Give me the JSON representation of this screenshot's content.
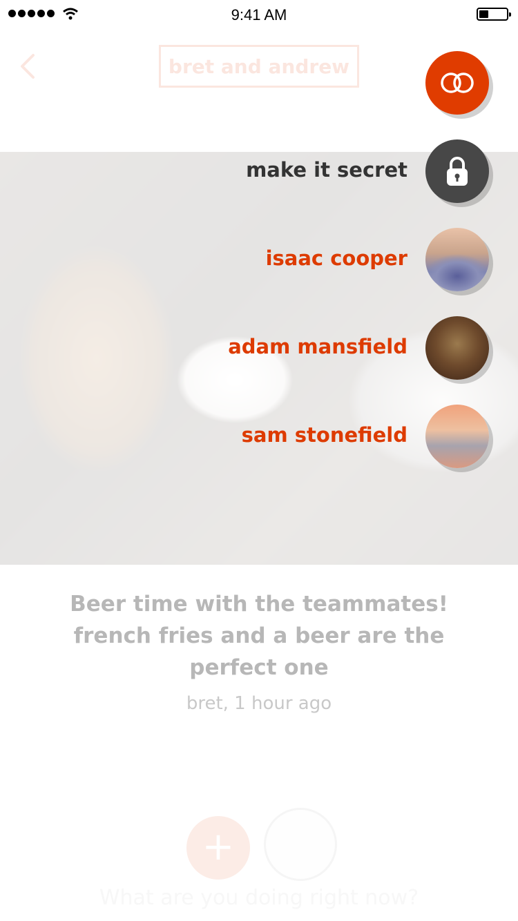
{
  "status_bar": {
    "time": "9:41 AM",
    "battery_level": 0.35
  },
  "header": {
    "title": "bret and andrew",
    "back_icon": "chevron-left-icon"
  },
  "post": {
    "caption": "Beer time with the teammates! french fries and a beer are the perfect one",
    "meta": "bret, 1 hour ago",
    "bottom_prompt": "What are you doing right now?"
  },
  "fab": {
    "icon": "linked-rings-icon",
    "color": "#e03c00"
  },
  "menu": {
    "secret_label": "make it secret",
    "secret_icon": "lock-icon",
    "people": [
      {
        "name": "isaac cooper"
      },
      {
        "name": "adam mansfield"
      },
      {
        "name": "sam stonefield"
      }
    ]
  },
  "colors": {
    "accent": "#dd3b00",
    "dark_text": "#333333",
    "lock_bg": "#474747"
  }
}
